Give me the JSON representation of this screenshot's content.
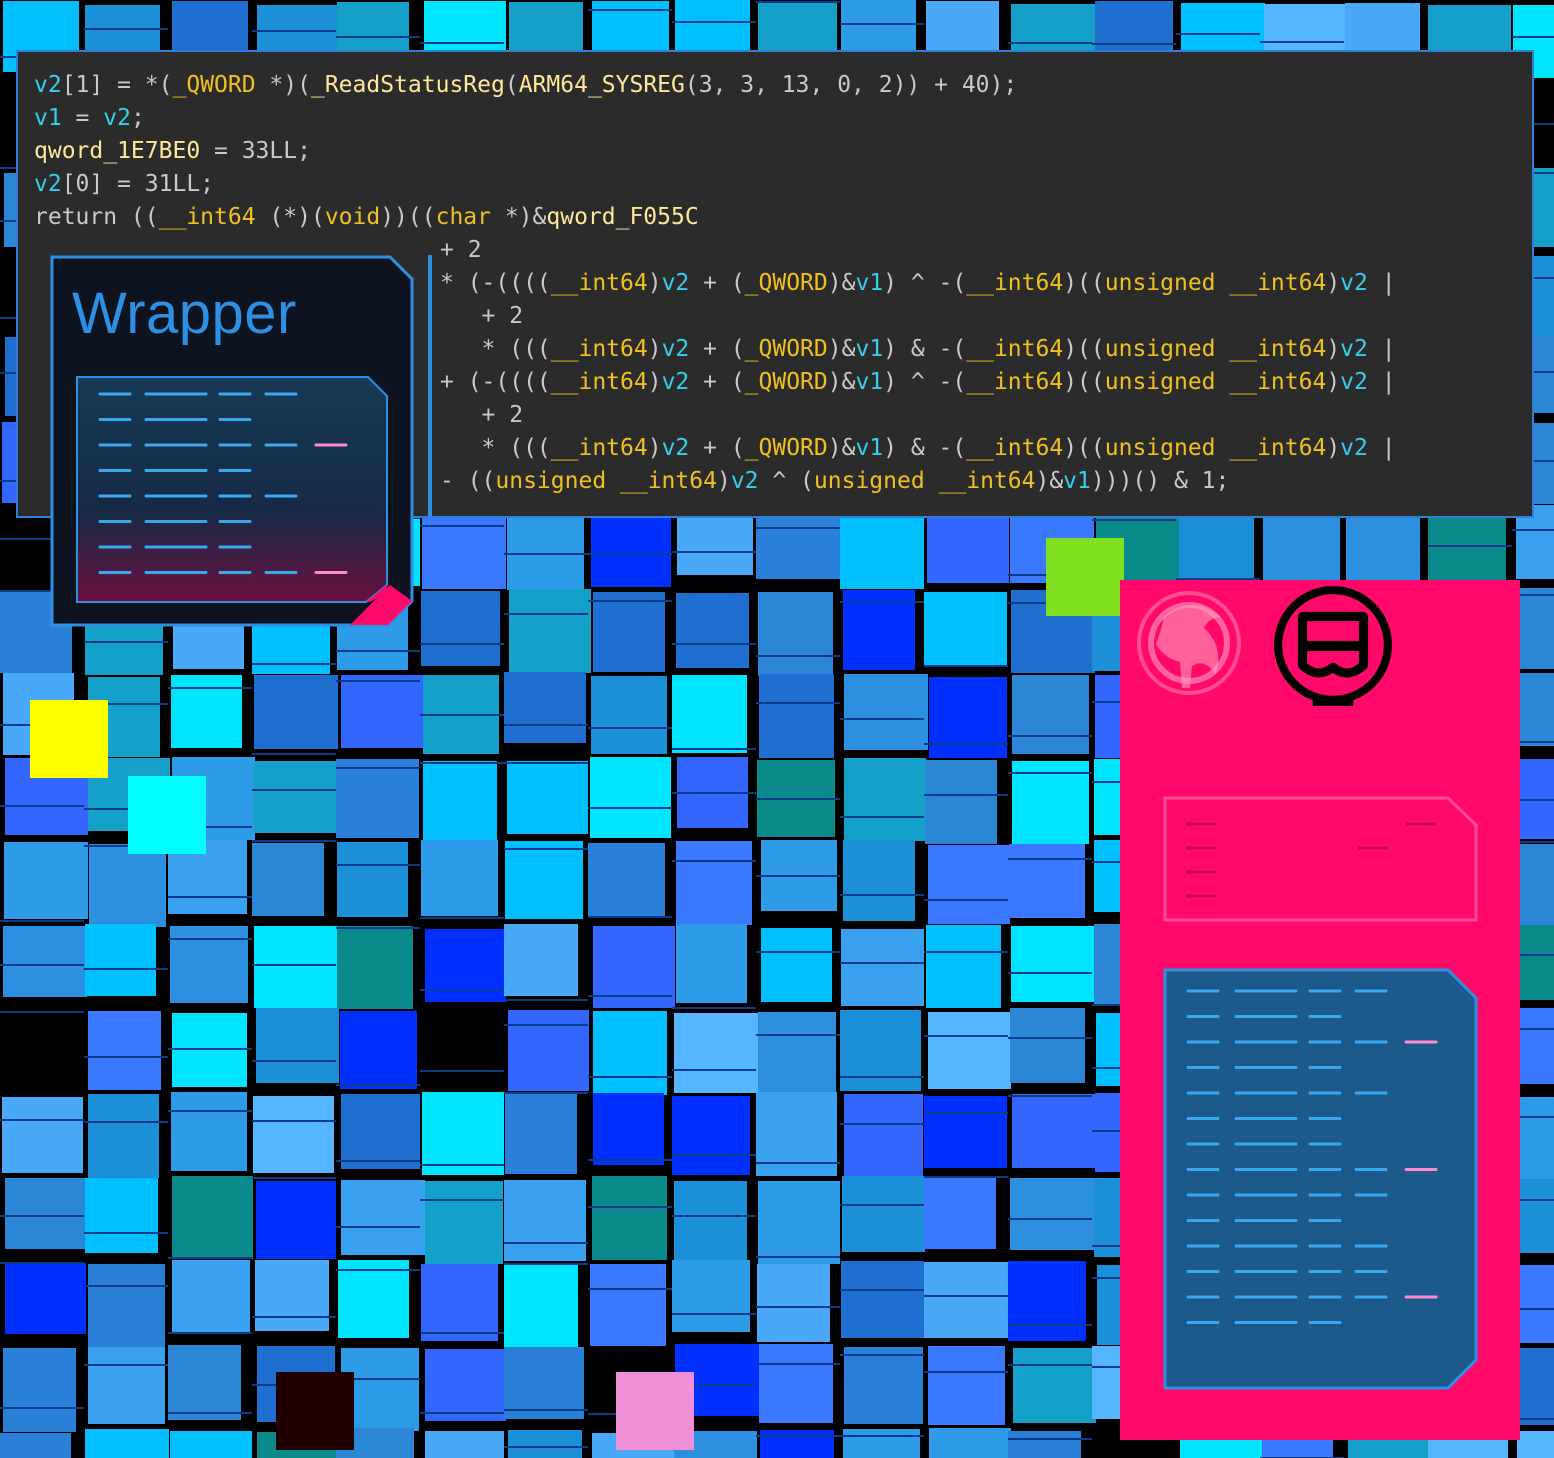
{
  "colors": {
    "code_bg": "#2b2b2b",
    "code_border": "#2f7fd6",
    "variable": "#33d0ee",
    "type_keyword": "#f0c020",
    "plain": "#c9c9c9",
    "accent_pink": "#ff0a6a",
    "accent_blue": "#2e8fe3"
  },
  "wrapper_card": {
    "title": "Wrapper"
  },
  "code": {
    "lines": [
      [
        {
          "t": "v2",
          "c": "v"
        },
        {
          "t": "[1] = *(",
          "c": "p"
        },
        {
          "t": "_QWORD",
          "c": "t"
        },
        {
          "t": " *)(",
          "c": "p"
        },
        {
          "t": "_ReadStatusReg",
          "c": "f"
        },
        {
          "t": "(",
          "c": "p"
        },
        {
          "t": "ARM64_SYSREG",
          "c": "f"
        },
        {
          "t": "(3, 3, 13, 0, 2)) + 40);",
          "c": "p"
        }
      ],
      [
        {
          "t": "v1",
          "c": "v"
        },
        {
          "t": " = ",
          "c": "p"
        },
        {
          "t": "v2",
          "c": "v"
        },
        {
          "t": ";",
          "c": "p"
        }
      ],
      [
        {
          "t": "qword_1E7BE0",
          "c": "f"
        },
        {
          "t": " = 33LL;",
          "c": "p"
        }
      ],
      [
        {
          "t": "v2",
          "c": "v"
        },
        {
          "t": "[0] = 31LL;",
          "c": "p"
        }
      ],
      [
        {
          "t": "return ((",
          "c": "p"
        },
        {
          "t": "__int64",
          "c": "t"
        },
        {
          "t": " (*)(",
          "c": "p"
        },
        {
          "t": "void",
          "c": "t"
        },
        {
          "t": "))((",
          "c": "p"
        },
        {
          "t": "char",
          "c": "t"
        },
        {
          "t": " *)&",
          "c": "p"
        },
        {
          "t": "qword_F055C",
          "c": "f"
        }
      ],
      [
        {
          "t": "+ 2",
          "c": "p"
        }
      ],
      [
        {
          "t": "* (-((((",
          "c": "p"
        },
        {
          "t": "__int64",
          "c": "t"
        },
        {
          "t": ")",
          "c": "p"
        },
        {
          "t": "v2",
          "c": "v"
        },
        {
          "t": " + (",
          "c": "p"
        },
        {
          "t": "_QWORD",
          "c": "t"
        },
        {
          "t": ")&",
          "c": "p"
        },
        {
          "t": "v1",
          "c": "v"
        },
        {
          "t": ") ^ -(",
          "c": "p"
        },
        {
          "t": "__int64",
          "c": "t"
        },
        {
          "t": ")((",
          "c": "p"
        },
        {
          "t": "unsigned __int64",
          "c": "t"
        },
        {
          "t": ")",
          "c": "p"
        },
        {
          "t": "v2",
          "c": "v"
        },
        {
          "t": " |",
          "c": "p"
        }
      ],
      [
        {
          "t": "   + 2",
          "c": "p"
        }
      ],
      [
        {
          "t": "   * (((",
          "c": "p"
        },
        {
          "t": "__int64",
          "c": "t"
        },
        {
          "t": ")",
          "c": "p"
        },
        {
          "t": "v2",
          "c": "v"
        },
        {
          "t": " + (",
          "c": "p"
        },
        {
          "t": "_QWORD",
          "c": "t"
        },
        {
          "t": ")&",
          "c": "p"
        },
        {
          "t": "v1",
          "c": "v"
        },
        {
          "t": ") & -(",
          "c": "p"
        },
        {
          "t": "__int64",
          "c": "t"
        },
        {
          "t": ")((",
          "c": "p"
        },
        {
          "t": "unsigned __int64",
          "c": "t"
        },
        {
          "t": ")",
          "c": "p"
        },
        {
          "t": "v2",
          "c": "v"
        },
        {
          "t": " |",
          "c": "p"
        }
      ],
      [
        {
          "t": "+ (-((((",
          "c": "p"
        },
        {
          "t": "__int64",
          "c": "t"
        },
        {
          "t": ")",
          "c": "p"
        },
        {
          "t": "v2",
          "c": "v"
        },
        {
          "t": " + (",
          "c": "p"
        },
        {
          "t": "_QWORD",
          "c": "t"
        },
        {
          "t": ")&",
          "c": "p"
        },
        {
          "t": "v1",
          "c": "v"
        },
        {
          "t": ") ^ -(",
          "c": "p"
        },
        {
          "t": "__int64",
          "c": "t"
        },
        {
          "t": ")((",
          "c": "p"
        },
        {
          "t": "unsigned __int64",
          "c": "t"
        },
        {
          "t": ")",
          "c": "p"
        },
        {
          "t": "v2",
          "c": "v"
        },
        {
          "t": " |",
          "c": "p"
        }
      ],
      [
        {
          "t": "   + 2",
          "c": "p"
        }
      ],
      [
        {
          "t": "   * (((",
          "c": "p"
        },
        {
          "t": "__int64",
          "c": "t"
        },
        {
          "t": ")",
          "c": "p"
        },
        {
          "t": "v2",
          "c": "v"
        },
        {
          "t": " + (",
          "c": "p"
        },
        {
          "t": "_QWORD",
          "c": "t"
        },
        {
          "t": ")&",
          "c": "p"
        },
        {
          "t": "v1",
          "c": "v"
        },
        {
          "t": ") & -(",
          "c": "p"
        },
        {
          "t": "__int64",
          "c": "t"
        },
        {
          "t": ")((",
          "c": "p"
        },
        {
          "t": "unsigned __int64",
          "c": "t"
        },
        {
          "t": ")",
          "c": "p"
        },
        {
          "t": "v2",
          "c": "v"
        },
        {
          "t": " |",
          "c": "p"
        }
      ],
      [
        {
          "t": "- ((",
          "c": "p"
        },
        {
          "t": "unsigned __int64",
          "c": "t"
        },
        {
          "t": ")",
          "c": "p"
        },
        {
          "t": "v2",
          "c": "v"
        },
        {
          "t": " ^ (",
          "c": "p"
        },
        {
          "t": "unsigned __int64",
          "c": "t"
        },
        {
          "t": ")&",
          "c": "p"
        },
        {
          "t": "v1",
          "c": "v"
        },
        {
          "t": ")))() & 1;",
          "c": "p"
        }
      ]
    ]
  },
  "icons": {
    "wrapper_listing": "code-listing-icon",
    "rabbit_logo": "rabbit-logo-icon",
    "ctf_logo": "masked-face-logo-icon",
    "pink_listing": "obfuscated-code-icon",
    "blue_listing": "code-listing-icon"
  }
}
